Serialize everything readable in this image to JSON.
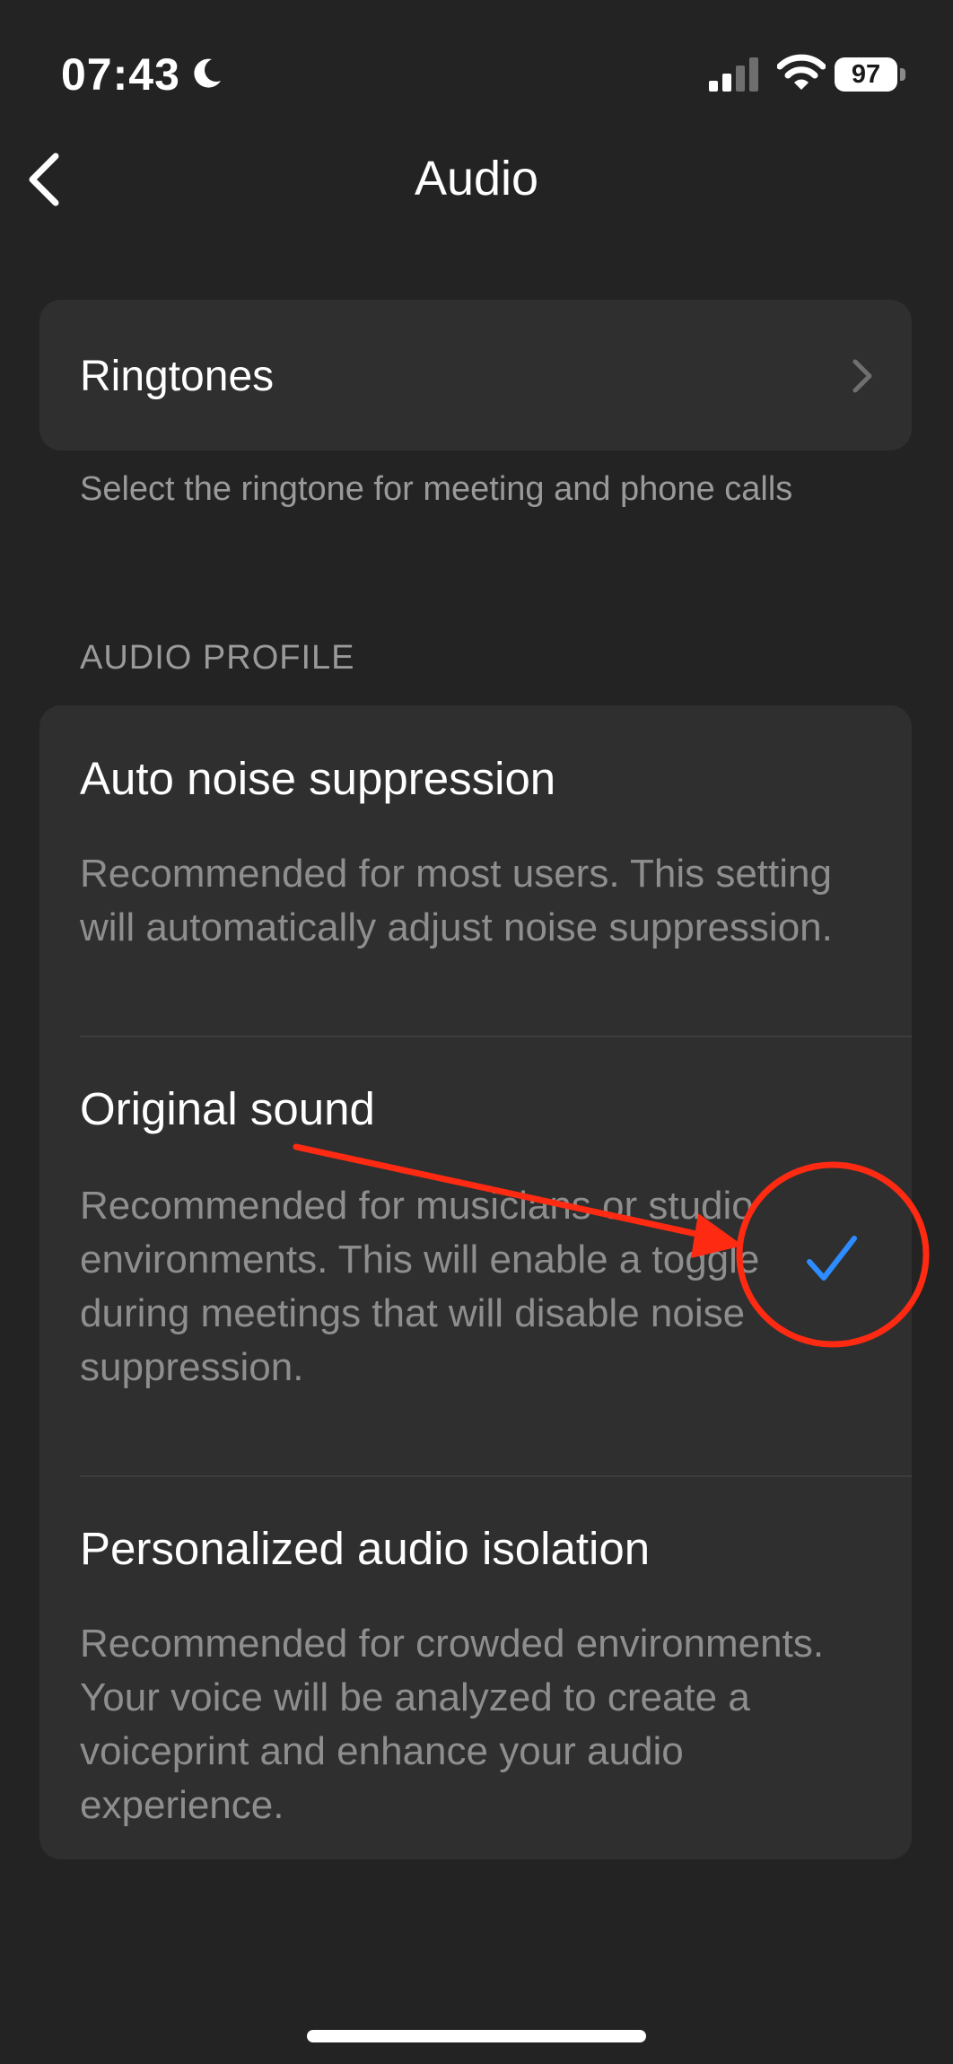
{
  "status_bar": {
    "time": "07:43",
    "battery_level": "97",
    "icons": [
      "moon-icon",
      "signal-icon",
      "wifi-icon",
      "battery-icon"
    ]
  },
  "nav": {
    "title": "Audio",
    "back_icon": "chevron-left-icon"
  },
  "ringtones": {
    "label": "Ringtones",
    "footnote": "Select the ringtone for meeting and phone calls"
  },
  "audio_profile": {
    "header": "AUDIO PROFILE",
    "options": [
      {
        "title": "Auto noise suppression",
        "description": "Recommended for most users. This setting will automatically adjust noise suppression.",
        "selected": false
      },
      {
        "title": "Original sound",
        "description": "Recommended for musicians or studio environments. This will enable a toggle during meetings that will disable noise suppression.",
        "selected": true
      },
      {
        "title": "Personalized audio isolation",
        "description": "Recommended for crowded environments. Your voice will be analyzed to create a voiceprint and enhance your audio experience.",
        "selected": false
      }
    ]
  },
  "colors": {
    "background": "#232323",
    "card": "#2f2f2f",
    "secondary_text": "#8e8e8e",
    "accent_check": "#2d8cff",
    "annotation_red": "#ff2a12"
  }
}
